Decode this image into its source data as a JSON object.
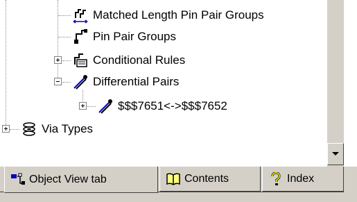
{
  "tree": {
    "items": [
      {
        "label": "Matched Length Pin Pair Groups",
        "icon": "matched-length-icon"
      },
      {
        "label": "Pin Pair Groups",
        "icon": "pin-pair-icon"
      },
      {
        "label": "Conditional Rules",
        "icon": "conditional-rules-icon"
      },
      {
        "label": "Differential Pairs",
        "icon": "differential-pair-icon"
      },
      {
        "label": "$$$7651<->$$$7652",
        "icon": "differential-pair-icon"
      },
      {
        "label": "Via Types",
        "icon": "via-types-icon"
      }
    ]
  },
  "tabs": [
    {
      "label": "Object View tab",
      "icon": "object-view-icon",
      "active": true
    },
    {
      "label": "Contents",
      "icon": "book-icon",
      "active": false
    },
    {
      "label": "Index",
      "icon": "question-icon",
      "active": false
    }
  ],
  "colors": {
    "window_bg": "#ffffff",
    "chrome": "#d4d0c8",
    "accent_blue": "#0000c0"
  }
}
